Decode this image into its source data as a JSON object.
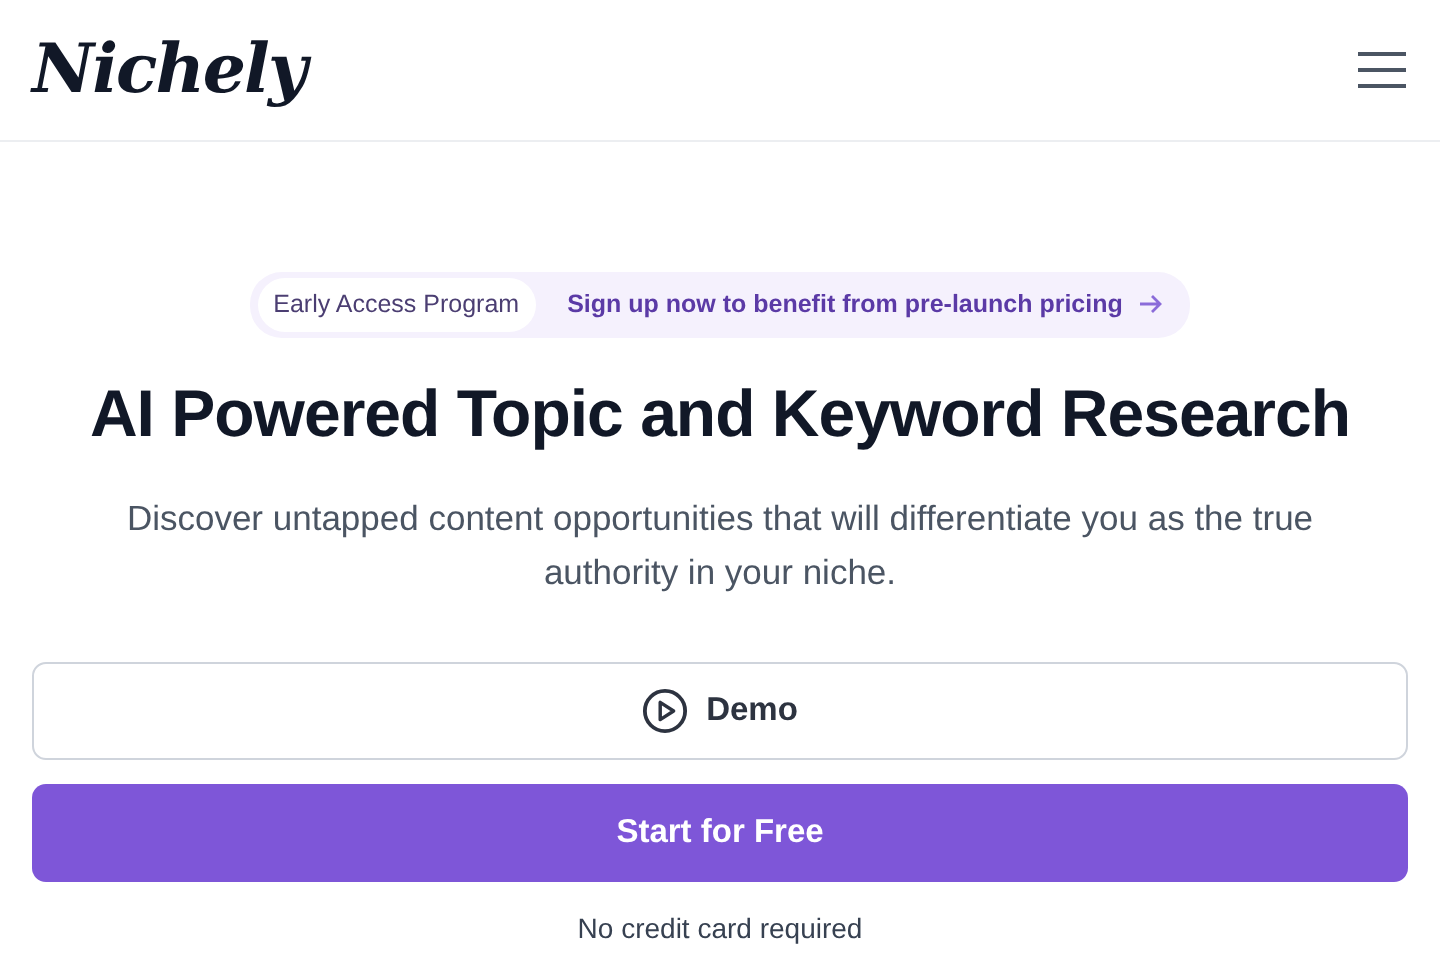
{
  "header": {
    "logo": "Nichely"
  },
  "announcement": {
    "badge": "Early Access Program",
    "link": "Sign up now to benefit from pre-launch pricing"
  },
  "heading": "AI Powered Topic and Keyword Research",
  "subheading": "Discover untapped content opportunities that will differentiate you as the true authority in your niche.",
  "buttons": [
    {
      "label": "Demo",
      "kind": "secondary"
    },
    {
      "label": "Start for Free",
      "kind": "primary"
    }
  ],
  "note": "No credit card required"
}
